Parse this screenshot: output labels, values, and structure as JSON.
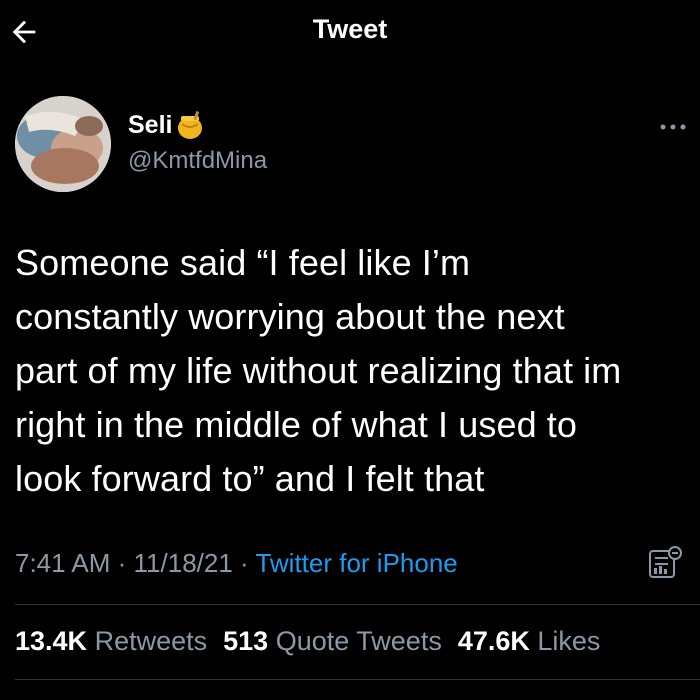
{
  "header": {
    "title": "Tweet",
    "back_icon": "arrow-left-icon"
  },
  "author": {
    "name": "Seli",
    "emoji_icon": "honey-pot-icon",
    "handle": "@KmtfdMina"
  },
  "tweet": {
    "lines": [
      "Someone said “I feel like I’m",
      "constantly worrying about the next",
      "part of my life without realizing that im",
      "right in the middle of what I used to",
      "look forward to” and I felt that"
    ]
  },
  "meta": {
    "time": "7:41 AM",
    "sep1": " · ",
    "date": "11/18/21",
    "sep2": " · ",
    "source": "Twitter for iPhone"
  },
  "stats": {
    "retweets_count": "13.4K",
    "retweets_label": "Retweets",
    "quotes_count": "513",
    "quotes_label": "Quote Tweets",
    "likes_count": "47.6K",
    "likes_label": "Likes"
  },
  "colors": {
    "background": "#000000",
    "text": "#ffffff",
    "secondary": "#8b98a5",
    "link": "#1d9bf0",
    "divider": "#2f3336"
  }
}
